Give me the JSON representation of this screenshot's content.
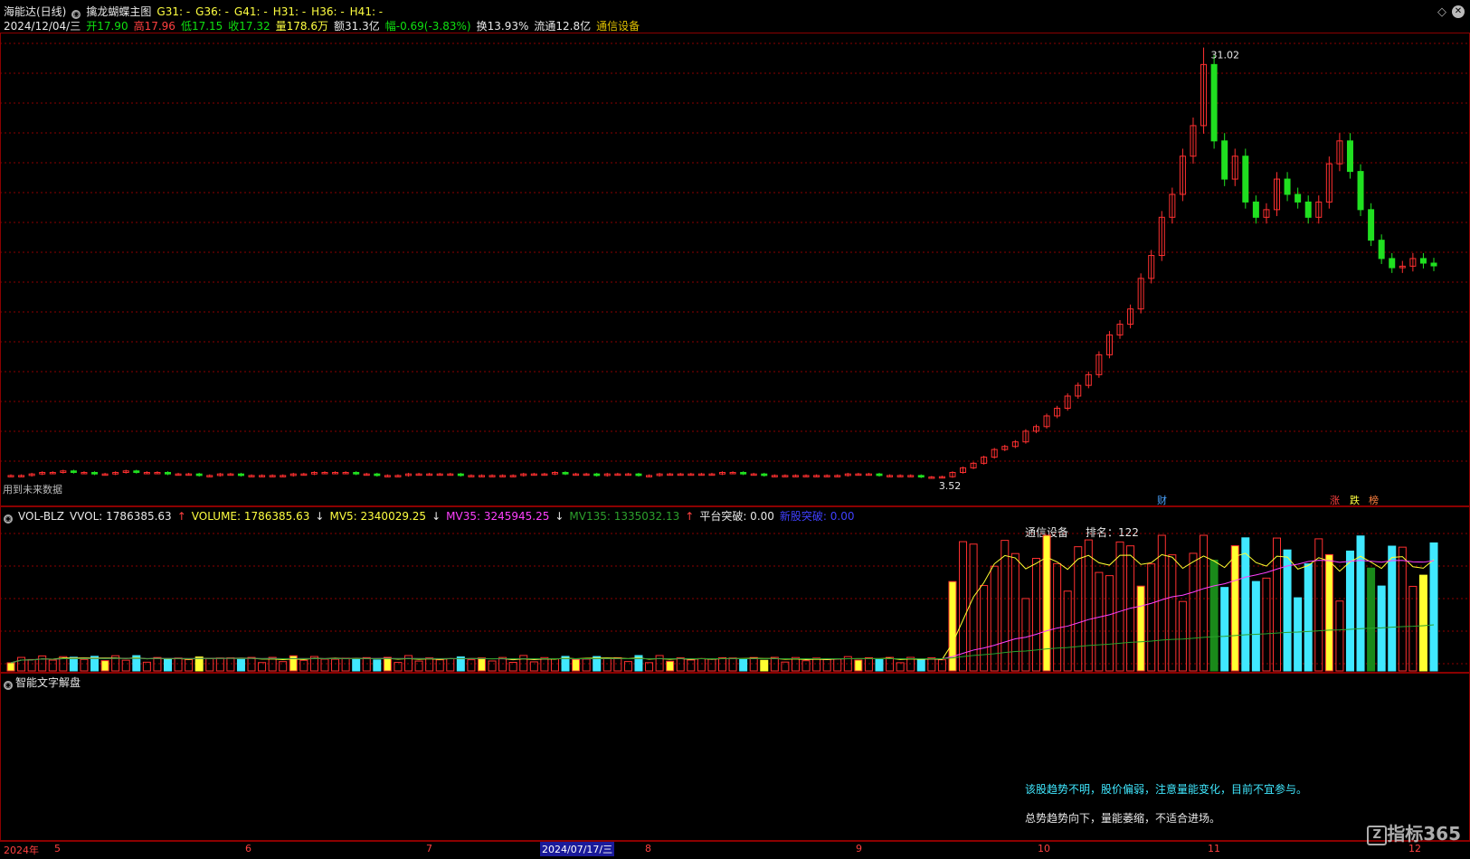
{
  "header": {
    "stock_name": "海能达(日线)",
    "indicator_name": "擒龙蝴蝶主图",
    "g31": "G31: -",
    "g36": "G36: -",
    "g41": "G41: -",
    "h31": "H31: -",
    "h36": "H36: -",
    "h41": "H41: -"
  },
  "quote": {
    "date": "2024/12/04/三",
    "open": "开17.90",
    "high": "高17.96",
    "low": "低17.15",
    "close": "收17.32",
    "volume": "量178.6万",
    "amount": "额31.3亿",
    "change": "幅-0.69(-3.83%)",
    "turnover": "换13.93%",
    "float": "流通12.8亿",
    "sector": "通信设备"
  },
  "main_chart": {
    "max_label": "31.02",
    "min_label": "3.52",
    "future_note": "用到未来数据",
    "badges": [
      "财",
      "涨",
      "跌",
      "榜"
    ]
  },
  "vol_header": {
    "name": "VOL-BLZ",
    "vvol": "VVOL: 1786385.63",
    "volume": "VOLUME: 1786385.63",
    "mv5": "MV5: 2340029.25",
    "mv35": "MV35: 3245945.25",
    "mv135": "MV135: 1335032.13",
    "platform": "平台突破: 0.00",
    "rookie": "新股突破: 0.00",
    "sector_rank_label": "通信设备",
    "rank": "排名：122"
  },
  "text_pane": {
    "title": "智能文字解盘",
    "line1": "该股趋势不明，股价偏弱，注意量能变化，目前不宜参与。",
    "line2": "总势趋势向下，量能萎缩，不适合进场。"
  },
  "x_axis": {
    "labels": [
      "2024年",
      "5",
      "6",
      "7",
      "2024/07/17/三",
      "8",
      "9",
      "10",
      "11",
      "12"
    ]
  },
  "watermark": "指标365",
  "colors": {
    "up": "#ff3030",
    "down": "#20e020",
    "cyan": "#40e8ff",
    "yellow": "#ffff30",
    "grid": "#8b0000"
  },
  "chart_data": {
    "type": "candlestick",
    "title": "",
    "closes": [
      3.6,
      3.6,
      3.7,
      3.8,
      3.8,
      3.9,
      3.8,
      3.8,
      3.7,
      3.7,
      3.8,
      3.9,
      3.8,
      3.8,
      3.8,
      3.7,
      3.7,
      3.7,
      3.6,
      3.6,
      3.7,
      3.7,
      3.6,
      3.6,
      3.6,
      3.6,
      3.6,
      3.7,
      3.7,
      3.8,
      3.8,
      3.8,
      3.8,
      3.7,
      3.7,
      3.6,
      3.6,
      3.6,
      3.7,
      3.7,
      3.7,
      3.7,
      3.7,
      3.6,
      3.6,
      3.6,
      3.6,
      3.6,
      3.6,
      3.7,
      3.7,
      3.7,
      3.8,
      3.7,
      3.7,
      3.7,
      3.6,
      3.7,
      3.7,
      3.7,
      3.6,
      3.6,
      3.7,
      3.7,
      3.7,
      3.7,
      3.7,
      3.7,
      3.8,
      3.8,
      3.7,
      3.7,
      3.6,
      3.6,
      3.6,
      3.6,
      3.6,
      3.6,
      3.6,
      3.6,
      3.7,
      3.7,
      3.7,
      3.6,
      3.6,
      3.6,
      3.6,
      3.5,
      3.5,
      3.52,
      3.8,
      4.1,
      4.4,
      4.8,
      5.3,
      5.5,
      5.8,
      6.5,
      6.8,
      7.5,
      8.0,
      8.8,
      9.5,
      10.2,
      11.5,
      12.8,
      13.5,
      14.5,
      16.5,
      18.0,
      20.5,
      22.0,
      24.5,
      26.5,
      30.5,
      25.5,
      23.0,
      24.5,
      21.5,
      20.5,
      21.0,
      23.0,
      22.0,
      21.5,
      20.5,
      21.5,
      24.0,
      25.5,
      23.5,
      21.0,
      19.0,
      17.8,
      17.2,
      17.3,
      17.8,
      17.5,
      17.32
    ],
    "price_range": [
      3.0,
      32.0
    ],
    "max_value": 31.02,
    "min_value": 3.52
  }
}
